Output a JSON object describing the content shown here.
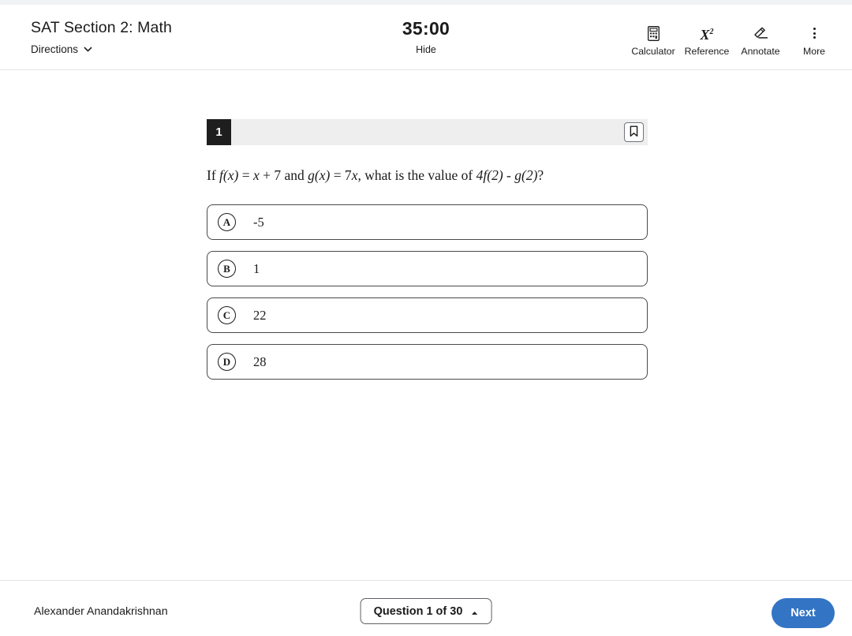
{
  "header": {
    "title": "SAT Section 2: Math",
    "directions_label": "Directions",
    "directions_icon": "chevron-down-icon",
    "timer": "35:00",
    "hide_label": "Hide",
    "tools": [
      {
        "label": "Calculator",
        "icon": "calculator-icon"
      },
      {
        "label": "Reference",
        "icon": "x-squared-icon",
        "glyph": "X",
        "glyph_sup": "2"
      },
      {
        "label": "Annotate",
        "icon": "pencil-icon"
      },
      {
        "label": "More",
        "icon": "more-vertical-icon"
      }
    ]
  },
  "question": {
    "number": "1",
    "bookmark_icon": "bookmark-icon",
    "prompt_parts": [
      {
        "text": "If ",
        "italic": false
      },
      {
        "text": "f(x)",
        "italic": true
      },
      {
        "text": " = ",
        "italic": false
      },
      {
        "text": "x",
        "italic": true
      },
      {
        "text": " + 7 and ",
        "italic": false
      },
      {
        "text": "g(x)",
        "italic": true
      },
      {
        "text": " = 7",
        "italic": false
      },
      {
        "text": "x",
        "italic": true
      },
      {
        "text": ", what is the value of ",
        "italic": false
      },
      {
        "text": "4f(2) - g(2)",
        "italic": true
      },
      {
        "text": "?",
        "italic": false
      }
    ],
    "prompt_plain": "If f(x) = x + 7 and g(x) = 7x, what is the value of 4f(2) - g(2)?",
    "choices": [
      {
        "letter": "A",
        "text": "-5"
      },
      {
        "letter": "B",
        "text": "1"
      },
      {
        "letter": "C",
        "text": "22"
      },
      {
        "letter": "D",
        "text": "28"
      }
    ]
  },
  "footer": {
    "student_name": "Alexander Anandakrishnan",
    "question_nav_label": "Question 1 of 30",
    "question_nav_icon": "chevron-up-icon",
    "next_label": "Next"
  },
  "colors": {
    "accent_blue": "#3374c4",
    "question_badge": "#1e1e1e",
    "question_bar": "#eeeeee",
    "text": "#1b1b1b",
    "border": "#e4e5e7"
  }
}
